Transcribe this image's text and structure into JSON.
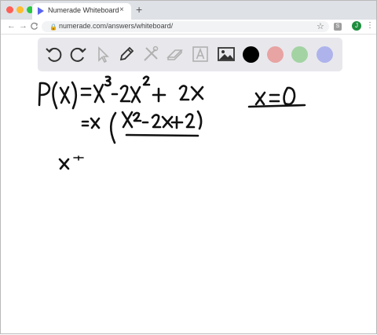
{
  "browser": {
    "tab_title": "Numerade Whiteboard",
    "tab_close": "×",
    "new_tab": "+",
    "url": "numerade.com/answers/whiteboard/",
    "back": "←",
    "forward": "→",
    "reload": "C",
    "star": "☆",
    "extension_label": "S",
    "avatar_label": "J",
    "menu": "⋮"
  },
  "whiteboard": {
    "tools": [
      "undo",
      "redo",
      "select",
      "pen",
      "tools",
      "eraser",
      "text",
      "image"
    ],
    "colors": [
      "#000000",
      "#e8a3a3",
      "#a3d3a3",
      "#aeb3ec"
    ],
    "selected_color": "#000000"
  },
  "handwriting": {
    "line1": "P(x)=x^3-2x^2+2x",
    "line2": "=x(x^2-2x+2)",
    "line3": "x",
    "side": "x=0"
  }
}
